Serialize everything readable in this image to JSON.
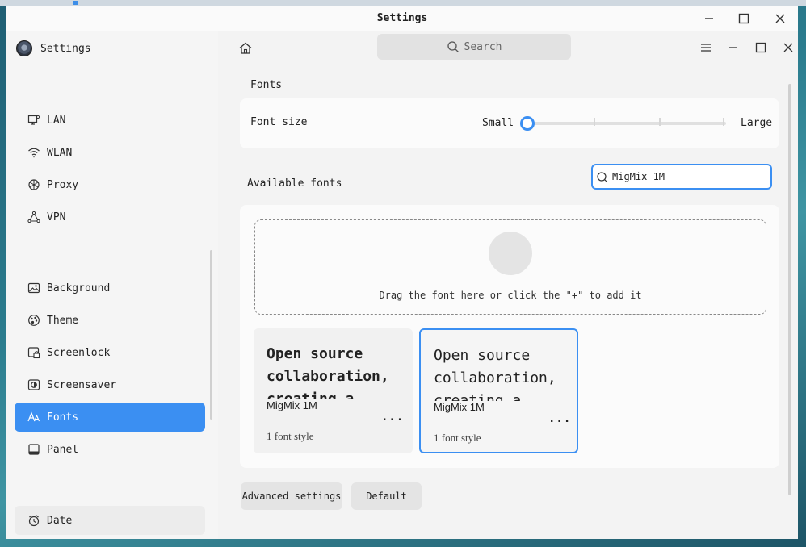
{
  "window": {
    "title": "Settings"
  },
  "app": {
    "name": "Settings"
  },
  "sidebar": {
    "items": [
      {
        "label": "LAN",
        "icon": "lan-icon"
      },
      {
        "label": "WLAN",
        "icon": "wifi-icon"
      },
      {
        "label": "Proxy",
        "icon": "proxy-icon"
      },
      {
        "label": "VPN",
        "icon": "vpn-icon"
      },
      {
        "label": "Background",
        "icon": "image-icon"
      },
      {
        "label": "Theme",
        "icon": "palette-icon"
      },
      {
        "label": "Screenlock",
        "icon": "screenlock-icon"
      },
      {
        "label": "Screensaver",
        "icon": "screensaver-icon"
      },
      {
        "label": "Fonts",
        "icon": "fonts-icon",
        "active": true
      },
      {
        "label": "Panel",
        "icon": "panel-icon"
      },
      {
        "label": "Date",
        "icon": "clock-icon"
      }
    ]
  },
  "header": {
    "search_placeholder": "Search"
  },
  "main": {
    "section_title": "Fonts",
    "font_size": {
      "label": "Font size",
      "min_label": "Small",
      "max_label": "Large",
      "level": 0
    },
    "available_fonts": {
      "label": "Available fonts",
      "search_value": "MigMix 1M"
    },
    "dropzone_text": "Drag the font here or click the \"+\" to add it",
    "tiles": [
      {
        "preview": "Open source collaboration, creating a better",
        "name": "MigMix 1M",
        "styles": "1 font style",
        "more": "..."
      },
      {
        "preview": "Open source collaboration, creating a better",
        "name": "MigMix 1M",
        "styles": "1 font style",
        "more": "..."
      }
    ],
    "advanced_label": "Advanced settings",
    "default_label": "Default"
  },
  "colors": {
    "accent": "#3b8ff2",
    "sidebar_bg": "#f5f5f5",
    "card_bg": "#fbfbfb"
  }
}
